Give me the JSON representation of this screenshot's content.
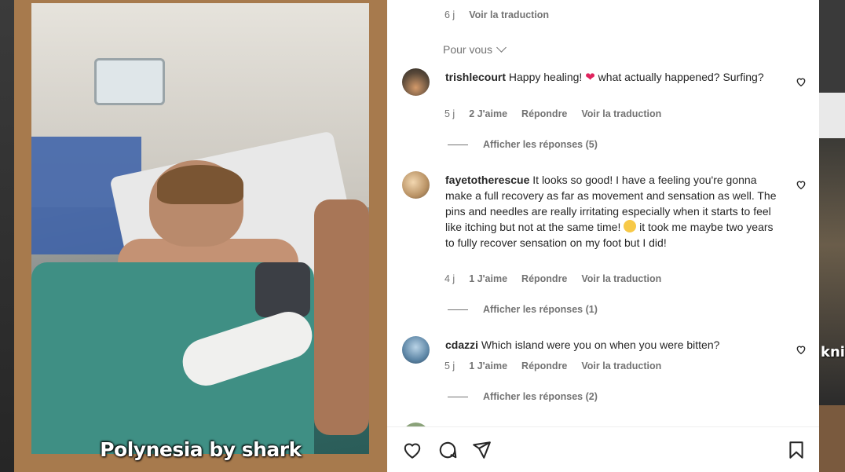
{
  "media": {
    "caption": "Polynesia by shark"
  },
  "background_right_text": "knif",
  "top_meta": {
    "time": "6 j",
    "translate": "Voir la traduction"
  },
  "for_you": {
    "label": "Pour vous"
  },
  "comments": [
    {
      "username": "trishlecourt",
      "text_before": "Happy healing!",
      "emoji": "heart",
      "text_after": "what actually happened? Surfing?",
      "time": "5 j",
      "likes": "2 J'aime",
      "reply": "Répondre",
      "translate": "Voir la traduction",
      "replies": "Afficher les réponses (5)"
    },
    {
      "username": "fayetotherescue",
      "text_before": "It looks so good! I have a feeling you're gonna make a full recovery as far as movement and sensation as well. The pins and needles are really irritating especially when it starts to feel like itching but not at the same time!",
      "emoji": "laugh",
      "text_after": "it took me maybe two years to fully recover sensation on my foot but I did!",
      "time": "4 j",
      "likes": "1 J'aime",
      "reply": "Répondre",
      "translate": "Voir la traduction",
      "replies": "Afficher les réponses (1)"
    },
    {
      "username": "cdazzi",
      "text_before": "Which island were you on when you were bitten?",
      "emoji": "",
      "text_after": "",
      "time": "5 j",
      "likes": "1 J'aime",
      "reply": "Répondre",
      "translate": "Voir la traduction",
      "replies": "Afficher les réponses (2)"
    }
  ],
  "actions": {
    "like": "heart-icon",
    "comment": "comment-icon",
    "share": "send-icon",
    "save": "bookmark-icon"
  }
}
